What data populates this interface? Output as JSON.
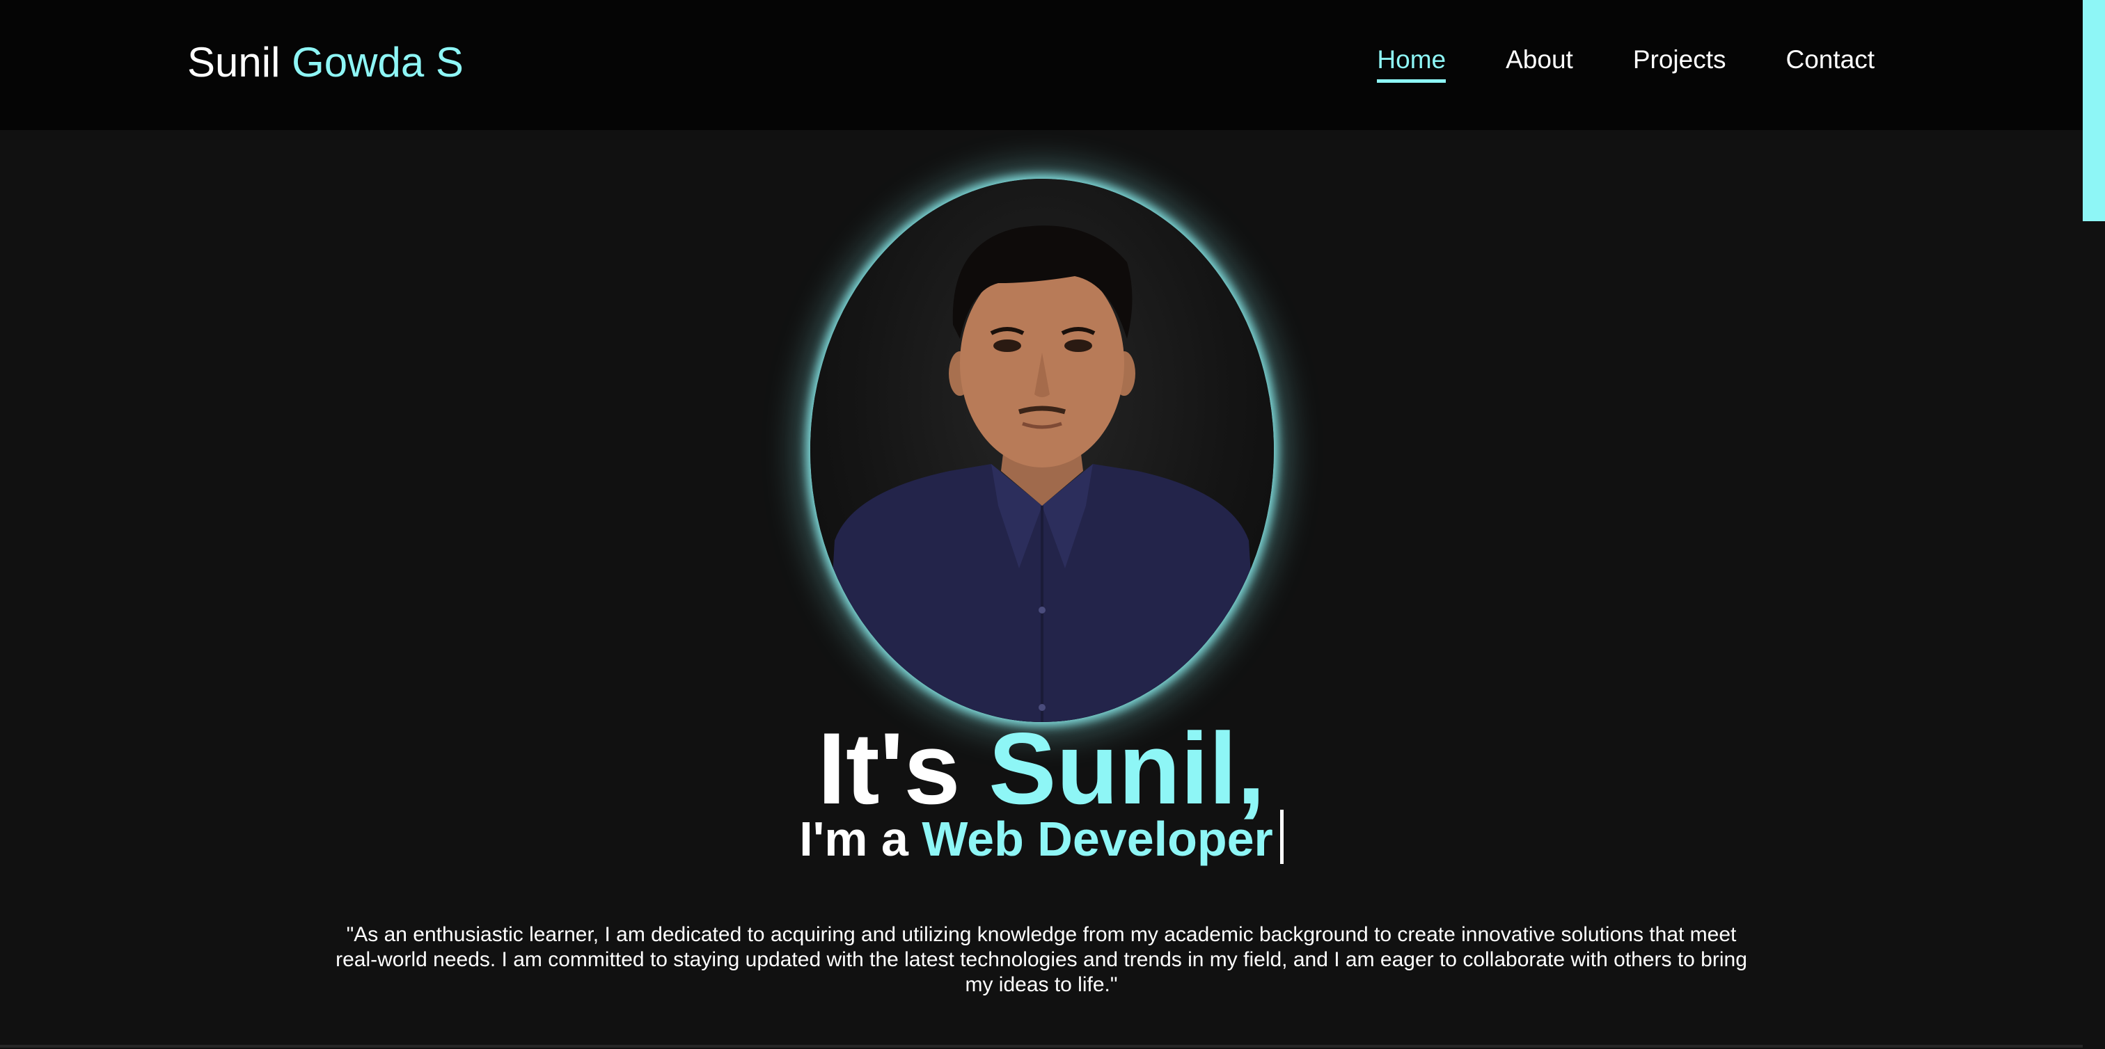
{
  "header": {
    "logo_first": "Sunil",
    "logo_accent": "Gowda S",
    "nav": [
      {
        "label": "Home",
        "active": true
      },
      {
        "label": "About",
        "active": false
      },
      {
        "label": "Projects",
        "active": false
      },
      {
        "label": "Contact",
        "active": false
      }
    ]
  },
  "hero": {
    "title_prefix": "It's",
    "title_accent": "Sunil,",
    "subtitle_prefix": "I'm a",
    "subtitle_accent": "Web Developer",
    "bio": "\"As an enthusiastic learner, I am dedicated to acquiring and utilizing knowledge from my academic background to create innovative solutions that meet real-world needs. I am committed to staying updated with the latest technologies and trends in my field, and I am eager to collaborate with others to bring my ideas to life.\""
  },
  "colors": {
    "accent": "#8ef6f6",
    "background": "#111111",
    "navbar": "#050505",
    "text": "#ffffff"
  },
  "icons": {
    "avatar": "profile-photo"
  }
}
